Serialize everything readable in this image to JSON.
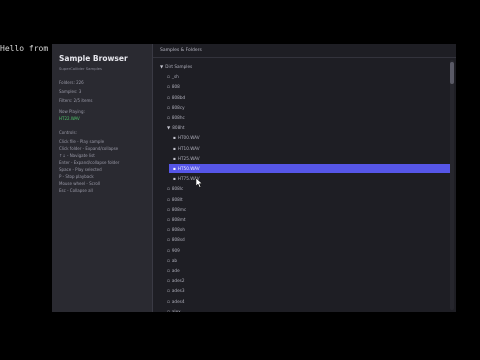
{
  "terminal": {
    "line": "Hello from th"
  },
  "sidebar": {
    "title": "Sample Browser",
    "subtitle": "SuperCollider Samples",
    "stats": [
      "Folders: 226",
      "Samples: 3",
      "Filters: 2/5 items"
    ],
    "now_playing_label": "Now Playing:",
    "now_playing_value": "HT22.WAV",
    "controls_title": "Controls:",
    "controls": [
      "Click file - Play sample",
      "Click folder - Expand/collapse",
      "↑↓ - Navigate list",
      "Enter - Expand/collapse folder",
      "Space - Play selected",
      "P - Stop playback",
      "Mouse wheel - Scroll",
      "Esc - Collapse all"
    ]
  },
  "main": {
    "header": "Samples & Folders",
    "tree": [
      {
        "glyph": "▼",
        "label": "Dirt Samples"
      },
      {
        "glyph": "▫",
        "label": "_sh"
      },
      {
        "glyph": "▫",
        "label": "808"
      },
      {
        "glyph": "▫",
        "label": "808bd"
      },
      {
        "glyph": "▫",
        "label": "808cy"
      },
      {
        "glyph": "▫",
        "label": "808hc"
      },
      {
        "glyph": "▼",
        "label": "808ht"
      },
      {
        "glyph": "▪",
        "label": "HT00.WAV"
      },
      {
        "glyph": "▪",
        "label": "HT10.WAV"
      },
      {
        "glyph": "▪",
        "label": "HT25.WAV"
      },
      {
        "glyph": "▪",
        "label": "HT50.WAV"
      },
      {
        "glyph": "▪",
        "label": "HT75.WAV"
      },
      {
        "glyph": "▫",
        "label": "808lc"
      },
      {
        "glyph": "▫",
        "label": "808lt"
      },
      {
        "glyph": "▫",
        "label": "808mc"
      },
      {
        "glyph": "▫",
        "label": "808mt"
      },
      {
        "glyph": "▫",
        "label": "808oh"
      },
      {
        "glyph": "▫",
        "label": "808sd"
      },
      {
        "glyph": "▫",
        "label": "909"
      },
      {
        "glyph": "▫",
        "label": "ab"
      },
      {
        "glyph": "▫",
        "label": "ade"
      },
      {
        "glyph": "▫",
        "label": "ades2"
      },
      {
        "glyph": "▫",
        "label": "ades3"
      },
      {
        "glyph": "▫",
        "label": "ades4"
      },
      {
        "glyph": "▫",
        "label": "alex"
      }
    ],
    "selected_index": 10
  },
  "colors": {
    "selection": "#5656e8",
    "now_playing": "#4fc46a"
  }
}
